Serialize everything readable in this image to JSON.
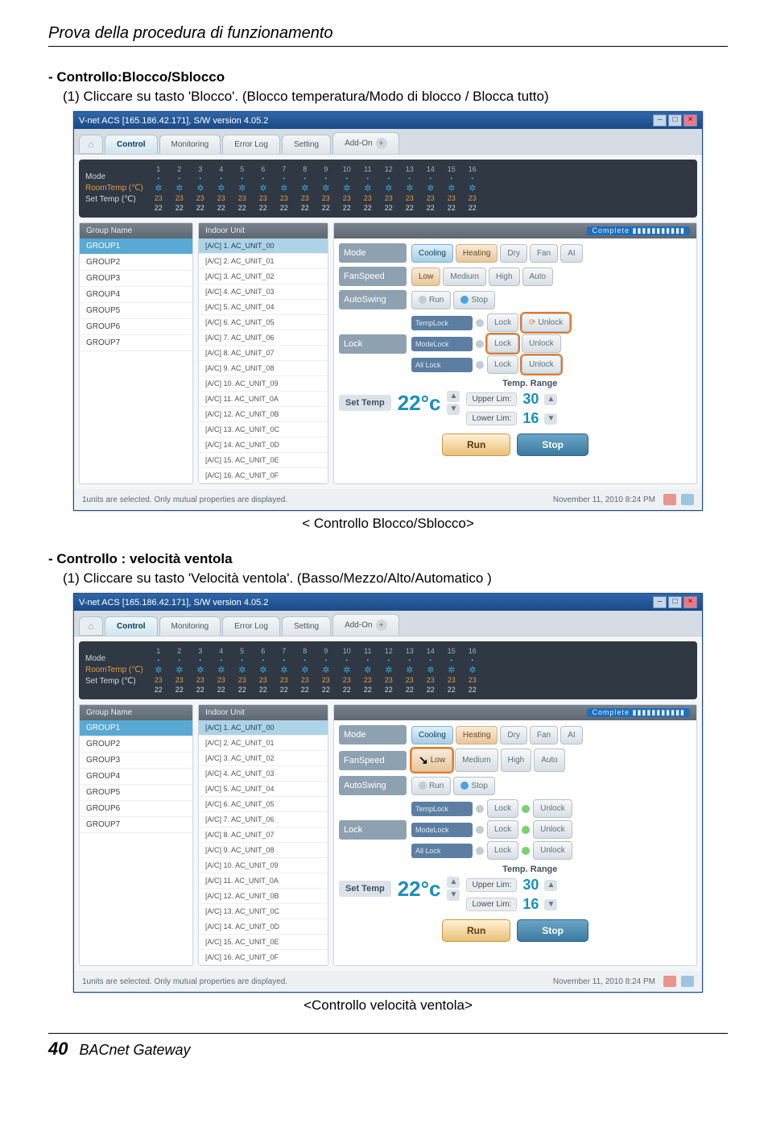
{
  "doc": {
    "section_title": "Prova della procedura di funzionamento",
    "page_number": "40",
    "footer": "BACnet Gateway"
  },
  "block1": {
    "heading": "- Controllo:Blocco/Sblocco",
    "instruction": "(1) Cliccare su tasto 'Blocco'. (Blocco temperatura/Modo di blocco / Blocca tutto)",
    "caption": "< Controllo Blocco/Sblocco>"
  },
  "block2": {
    "heading": "- Controllo : velocità ventola",
    "instruction": "(1) Cliccare su tasto 'Velocità ventola'. (Basso/Mezzo/Alto/Automatico )",
    "caption": "<Controllo velocità ventola>"
  },
  "app": {
    "titlebar": "V-net ACS [165.186.42.171],   S/W version 4.05.2",
    "tabs": {
      "home": "⌂",
      "control": "Control",
      "monitoring": "Monitoring",
      "errorlog": "Error Log",
      "setting": "Setting",
      "addon": "Add-On"
    },
    "mode_labels": {
      "mode": "Mode",
      "roomtemp": "RoomTemp (℃)",
      "settemp": "Set Temp  (℃)"
    },
    "unit_cells": {
      "count": 16,
      "t23": "23",
      "t22": "22"
    },
    "group_header": "Group Name",
    "groups": [
      "GROUP1",
      "GROUP2",
      "GROUP3",
      "GROUP4",
      "GROUP5",
      "GROUP6",
      "GROUP7"
    ],
    "indoor_header": "Indoor Unit",
    "indoor_units": [
      "[A/C] 1. AC_UNIT_00",
      "[A/C] 2. AC_UNIT_01",
      "[A/C] 3. AC_UNIT_02",
      "[A/C] 4. AC_UNIT_03",
      "[A/C] 5. AC_UNIT_04",
      "[A/C] 6. AC_UNIT_05",
      "[A/C] 7. AC_UNIT_06",
      "[A/C] 8. AC_UNIT_07",
      "[A/C] 9. AC_UNIT_08",
      "[A/C] 10. AC_UNIT_09",
      "[A/C] 11. AC_UNIT_0A",
      "[A/C] 12. AC_UNIT_0B",
      "[A/C] 13. AC_UNIT_0C",
      "[A/C] 14. AC_UNIT_0D",
      "[A/C] 15. AC_UNIT_0E",
      "[A/C] 16. AC_UNIT_0F"
    ],
    "complete": "Complete",
    "panel": {
      "mode": {
        "label": "Mode",
        "cooling": "Cooling",
        "heating": "Heating",
        "dry": "Dry",
        "fan": "Fan",
        "ai": "AI"
      },
      "fanspeed": {
        "label": "FanSpeed",
        "low": "Low",
        "medium": "Medium",
        "high": "High",
        "auto": "Auto"
      },
      "autoswing": {
        "label": "AutoSwing",
        "run": "Run",
        "stop": "Stop"
      },
      "lock": {
        "label": "Lock",
        "templock": "TempLock",
        "modelock": "ModeLock",
        "alllock": "All Lock",
        "lock_text": "Lock",
        "unlock_text": "Unlock"
      },
      "settemp": {
        "label": "Set Temp",
        "val": "22°c",
        "range_head": "Temp. Range",
        "upper": "Upper Lim:",
        "upper_v": "30",
        "lower": "Lower Lim:",
        "lower_v": "16"
      },
      "run": "Run",
      "stop": "Stop"
    },
    "status": {
      "left": "1units are selected. Only mutual properties are displayed.",
      "right": "November 11, 2010  8:24 PM"
    }
  }
}
